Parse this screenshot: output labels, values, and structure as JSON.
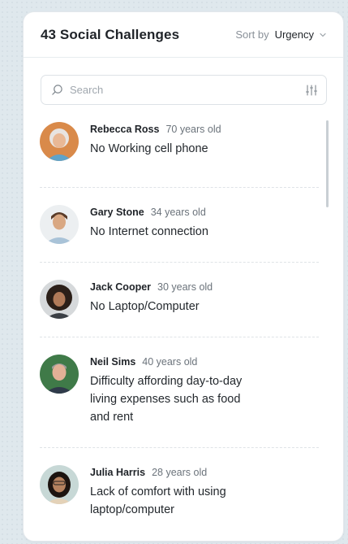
{
  "header": {
    "title": "43 Social Challenges",
    "sort_label": "Sort by",
    "sort_value": "Urgency"
  },
  "search": {
    "placeholder": "Search"
  },
  "challenges": [
    {
      "name": "Rebecca Ross",
      "age": "70 years old",
      "challenge": "No Working cell phone"
    },
    {
      "name": "Gary Stone",
      "age": "34 years old",
      "challenge": "No Internet connection"
    },
    {
      "name": "Jack Cooper",
      "age": "30 years old",
      "challenge": "No Laptop/Computer"
    },
    {
      "name": "Neil Sims",
      "age": "40 years old",
      "challenge": "Difficulty affording day-to-day living expenses such as food and rent"
    },
    {
      "name": "Julia Harris",
      "age": "28 years old",
      "challenge": "Lack of comfort with using laptop/computer"
    }
  ],
  "icons": {
    "sort": "chevron-down-icon",
    "search": "search-icon",
    "filter": "filter-sliders-icon"
  },
  "colors": {
    "text": "#1f2328",
    "muted": "#8a9199",
    "border": "#dde2e6",
    "background": "#dfe8ed"
  }
}
